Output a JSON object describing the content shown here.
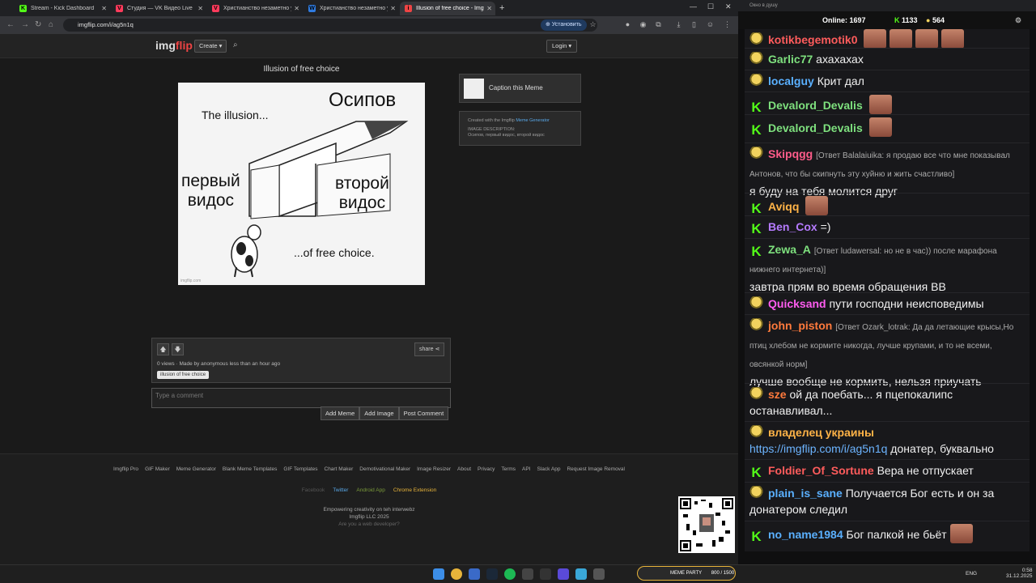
{
  "tabs": [
    {
      "label": "Stream - Kick Dashboard",
      "color": "#53fc18",
      "glyph": "K"
    },
    {
      "label": "Студия — VK Видео Live",
      "color": "#ff3b5c",
      "glyph": "V"
    },
    {
      "label": "Христианство незаметно уходит",
      "color": "#ff3b5c",
      "glyph": "V"
    },
    {
      "label": "Христианство незаметно уходит",
      "color": "#2f7be0",
      "glyph": "W"
    },
    {
      "label": "Illusion of free choice - Imgflip",
      "color": "#e44",
      "glyph": "i"
    }
  ],
  "address": {
    "url": "imgflip.com/i/ag5n1q",
    "install_label": "Установить"
  },
  "imgflip": {
    "logo_main": "img",
    "logo_accent": "flip",
    "create_label": "Create ▾",
    "login_label": "Login ▾",
    "meme_title": "Illusion of free choice",
    "meme_text": {
      "top_left": "The illusion...",
      "top_right": "Осипов",
      "left_door": "первый\nвидос",
      "right_door": "второй\nвидос",
      "bottom": "...of free choice.",
      "watermark": "imgflip.com"
    },
    "caption_label": "Caption this Meme",
    "info_created": "Created with the Imgflip ",
    "info_link": "Meme Generator",
    "info_desc_label": "IMAGE DESCRIPTION:",
    "info_desc": "Осипов, первый видос, второй видос",
    "share_label": "share",
    "vote_meta": "0 views · Made by anonymous less than an hour ago",
    "tag": "illusion of free choice",
    "comment_placeholder": "Type a comment",
    "comment_buttons": [
      "Add Meme",
      "Add Image",
      "Post Comment"
    ],
    "footer_links": [
      "Imgflip Pro",
      "GIF Maker",
      "Meme Generator",
      "Blank Meme Templates",
      "GIF Templates",
      "Chart Maker",
      "Demotivational Maker",
      "Image Resizer",
      "About",
      "Privacy",
      "Terms",
      "API",
      "Slack App",
      "Request Image Removal"
    ],
    "social": [
      {
        "label": "Facebook",
        "color": "#555"
      },
      {
        "label": "Twitter",
        "color": "#58a8e8"
      },
      {
        "label": "Android App",
        "color": "#7a9a3a"
      },
      {
        "label": "Chrome Extension",
        "color": "#e8b43a"
      }
    ],
    "tagline": "Empowering creativity on teh interwebz",
    "copyright": "Imgflip LLC 2025",
    "dev": "Are you a web developer?"
  },
  "chat": {
    "window_title": "Окно в душу",
    "online_label": "Online:",
    "online_count": "1697",
    "kick_count": "1133",
    "other_count": "564",
    "messages": [
      {
        "user": "kotikbegemotik0",
        "color": "#ff5c5c",
        "badge": "y",
        "text": "",
        "emotes": 4
      },
      {
        "user": "Garlic77",
        "color": "#7ee07e",
        "badge": "y",
        "text": "ахахахах"
      },
      {
        "user": "localguy",
        "color": "#5ab0ff",
        "badge": "y",
        "text": "Крит дал"
      },
      {
        "user": "Devalord_Devalis",
        "color": "#7ee07e",
        "badge": "k",
        "text": "",
        "emotes": 1
      },
      {
        "user": "Devalord_Devalis",
        "color": "#7ee07e",
        "badge": "k",
        "text": "",
        "emotes": 1
      },
      {
        "user": "Skipqgg",
        "color": "#ff5c8a",
        "badge": "y",
        "reply": "[Ответ Balalaiuika: я продаю все что мне показывал Антонов, что бы скипнуть эту хуйню и жить счастливо]",
        "text": "я буду на тебя молится друг"
      },
      {
        "user": "Aviqq",
        "color": "#ffb347",
        "badge": "k",
        "text": "",
        "emotes": 1
      },
      {
        "user": "Ben_Cox",
        "color": "#b57bff",
        "badge": "k",
        "text": "=)"
      },
      {
        "user": "Zewa_A",
        "color": "#7ee07e",
        "badge": "k",
        "reply": "[Ответ ludawersal: но не в час)) после марафона нижнего интернета)]",
        "text": "завтра прям во время обращения ВВ"
      },
      {
        "user": "Quicksand",
        "color": "#ff5cf0",
        "badge": "y",
        "text": "пути господни неисповедимы"
      },
      {
        "user": "john_piston",
        "color": "#ff7a3c",
        "badge": "y",
        "reply": "[Ответ Ozark_lotrak: Да да летающие крысы,Но птиц хлебом не кормите никогда, лучше крупами, и то не всеми, овсянкой норм]",
        "text": "лучше вообще не кормить, нельзя приучать"
      },
      {
        "user": "sze",
        "color": "#ff7a3c",
        "badge": "y",
        "text": "ой да поебать... я пцепокалипс останавливал..."
      },
      {
        "user": "владелец украины",
        "color": "#ffb347",
        "badge": "y",
        "link": "https://imgflip.com/i/ag5n1q",
        "text": " донатер, буквально"
      },
      {
        "user": "Foldier_Of_Sortune",
        "color": "#ff5c5c",
        "badge": "k",
        "text": "Вера не отпускает"
      },
      {
        "user": "plain_is_sane",
        "color": "#5ab0ff",
        "badge": "y",
        "text": "Получается Бог есть и он за донатером следил"
      },
      {
        "user": "no_name1984",
        "color": "#5ab0ff",
        "badge": "k",
        "text": "Бог палкой не бьёт",
        "emotes": 1
      }
    ]
  },
  "taskbar": {
    "meme_party_label": "MEME PARTY",
    "meme_party_progress": "800 / 1500",
    "lang": "ENG",
    "time": "0:58",
    "date": "31.12.2025"
  }
}
